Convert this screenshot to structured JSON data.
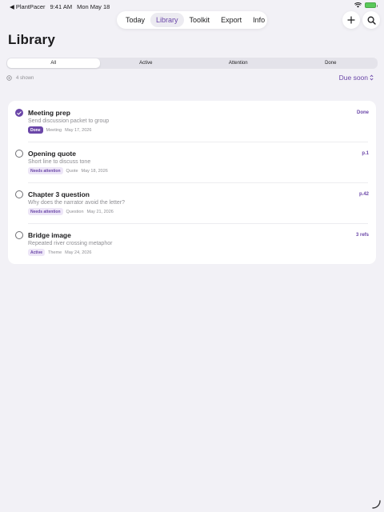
{
  "status_bar": {
    "back_app": "PlantPacer",
    "time": "9:41 AM",
    "date": "Mon May 18"
  },
  "nav": {
    "tabs": [
      "Today",
      "Library",
      "Toolkit",
      "Export",
      "Info"
    ],
    "active_tab": "Library"
  },
  "page": {
    "title": "Library"
  },
  "filters": {
    "segments": [
      "All",
      "Active",
      "Attention",
      "Done"
    ],
    "selected": "All"
  },
  "list_info": {
    "count_label": "4 shown",
    "sort_label": "Due soon"
  },
  "items": [
    {
      "title": "Meeting prep",
      "subtitle": "Send discussion packet to group",
      "badge": "Done",
      "type": "Meeting",
      "date": "May 17, 2026",
      "ref": "Done",
      "checked": true
    },
    {
      "title": "Opening quote",
      "subtitle": "Short line to discuss tone",
      "badge": "Needs attention",
      "type": "Quote",
      "date": "May 18, 2026",
      "ref": "p.1",
      "checked": false
    },
    {
      "title": "Chapter 3 question",
      "subtitle": "Why does the narrator avoid the letter?",
      "badge": "Needs attention",
      "type": "Question",
      "date": "May 21, 2026",
      "ref": "p.42",
      "checked": false
    },
    {
      "title": "Bridge image",
      "subtitle": "Repeated river crossing metaphor",
      "badge": "Active",
      "type": "Theme",
      "date": "May 24, 2026",
      "ref": "3 refs",
      "checked": false
    }
  ],
  "colors": {
    "accent": "#6b47a8",
    "background": "#f2f1f6",
    "card": "#ffffff",
    "secondary_text": "#8e8e93",
    "badge_tint": "#ede6f7"
  }
}
